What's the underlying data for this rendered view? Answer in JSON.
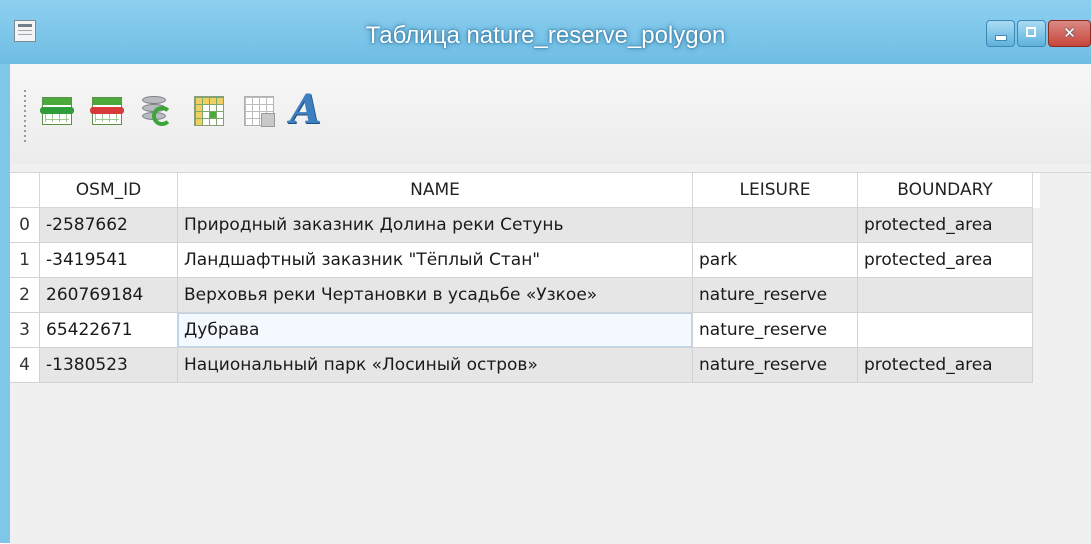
{
  "window": {
    "title": "Таблица nature_reserve_polygon",
    "controls": [
      "minimize",
      "maximize",
      "close"
    ]
  },
  "toolbar": {
    "buttons": [
      {
        "name": "add-row-icon"
      },
      {
        "name": "delete-row-icon"
      },
      {
        "name": "refresh-data-icon"
      },
      {
        "name": "table-select-icon"
      },
      {
        "name": "table-properties-icon"
      },
      {
        "name": "font-icon",
        "glyph": "A"
      }
    ]
  },
  "table": {
    "columns": [
      "OSM_ID",
      "NAME",
      "LEISURE",
      "BOUNDARY"
    ],
    "rows": [
      {
        "index": "0",
        "osm_id": "-2587662",
        "name": "Природный заказник Долина реки Сетунь",
        "leisure": "",
        "boundary": "protected_area"
      },
      {
        "index": "1",
        "osm_id": "-3419541",
        "name": "Ландшафтный заказник \"Тёплый Стан\"",
        "leisure": "park",
        "boundary": "protected_area"
      },
      {
        "index": "2",
        "osm_id": "260769184",
        "name": "Верховья реки Чертановки в усадьбе «Узкое»",
        "leisure": "nature_reserve",
        "boundary": ""
      },
      {
        "index": "3",
        "osm_id": "65422671",
        "name": "Дубрава",
        "leisure": "nature_reserve",
        "boundary": ""
      },
      {
        "index": "4",
        "osm_id": "-1380523",
        "name": "Национальный парк «Лосиный остров»",
        "leisure": "nature_reserve",
        "boundary": "protected_area"
      }
    ]
  },
  "colors": {
    "titlebar": "#7fc6e9",
    "shaded_row": "#e6e6e6",
    "close_button": "#c9453a"
  }
}
